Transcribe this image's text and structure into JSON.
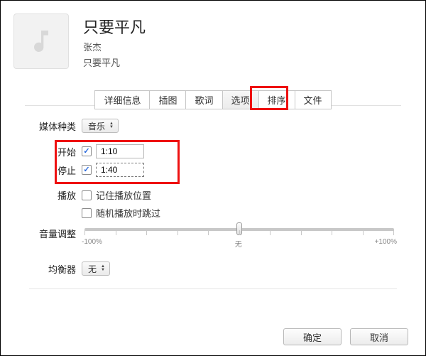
{
  "header": {
    "title": "只要平凡",
    "artist": "张杰",
    "album": "只要平凡"
  },
  "tabs": {
    "items": [
      "详细信息",
      "插图",
      "歌词",
      "选项",
      "排序",
      "文件"
    ],
    "active_index": 3
  },
  "labels": {
    "media_kind": "媒体种类",
    "start": "开始",
    "stop": "停止",
    "playback": "播放",
    "remember_position": "记住播放位置",
    "skip_shuffle": "随机播放时跳过",
    "volume_adjust": "音量调整",
    "equalizer": "均衡器"
  },
  "values": {
    "media_kind": "音乐",
    "start_checked": true,
    "start_time": "1:10",
    "stop_checked": true,
    "stop_time": "1:40",
    "remember_position_checked": false,
    "skip_shuffle_checked": false,
    "equalizer": "无"
  },
  "slider": {
    "left": "-100%",
    "mid": "无",
    "right": "+100%"
  },
  "footer": {
    "ok": "确定",
    "cancel": "取消"
  }
}
